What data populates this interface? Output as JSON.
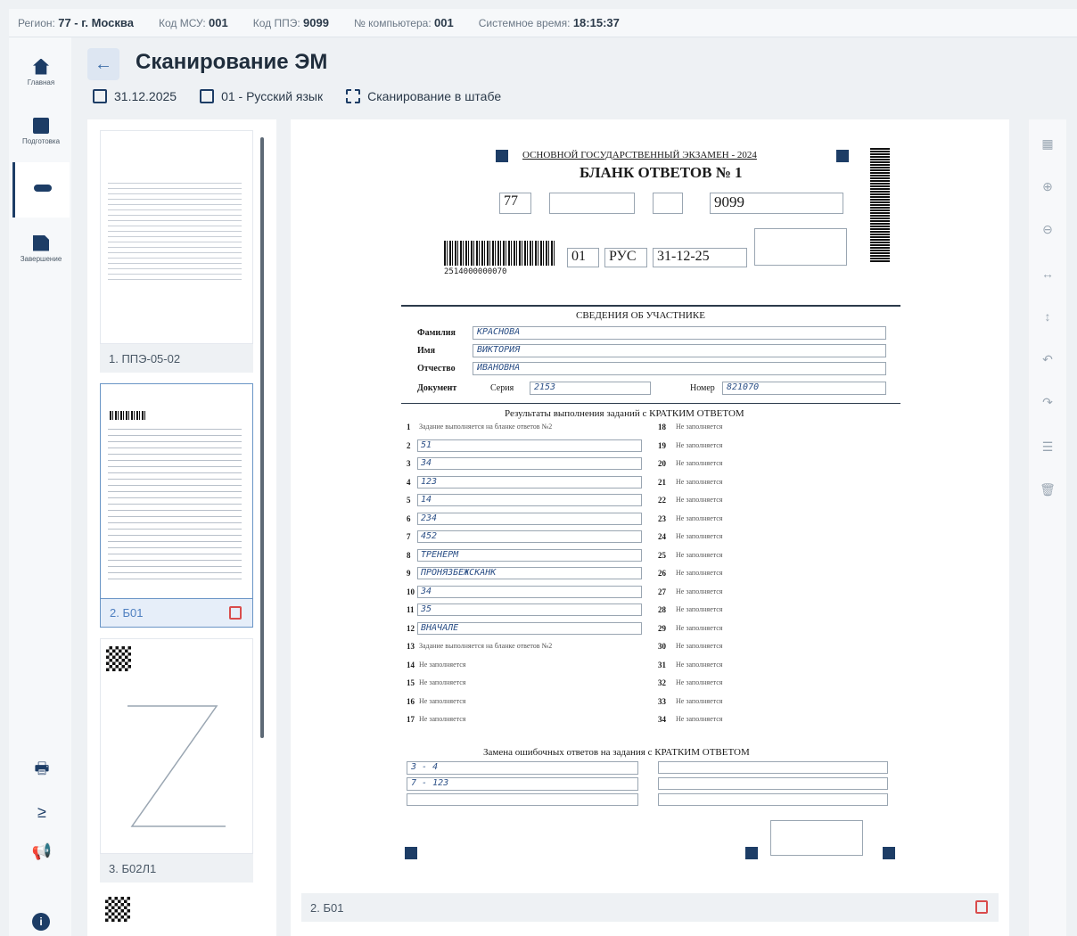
{
  "status": {
    "region_label": "Регион:",
    "region_value": "77 - г. Москва",
    "msu_label": "Код МСУ:",
    "msu_value": "001",
    "ppe_label": "Код ППЭ:",
    "ppe_value": "9099",
    "pc_label": "№ компьютера:",
    "pc_value": "001",
    "time_label": "Системное время:",
    "time_value": "18:15:37"
  },
  "sidebar": {
    "items": [
      {
        "label": "Главная",
        "icon": "home-icon"
      },
      {
        "label": "Подготовка",
        "icon": "calendar-icon"
      },
      {
        "label": "",
        "icon": "key-icon"
      },
      {
        "label": "Завершение",
        "icon": "document-icon"
      }
    ],
    "bottom": [
      "printer-icon",
      "scanner-icon",
      "megaphone-icon",
      "info-icon"
    ]
  },
  "header": {
    "title": "Сканирование ЭМ",
    "date": "31.12.2025",
    "subject": "01 - Русский язык",
    "mode": "Сканирование в штабе"
  },
  "thumbnails": [
    {
      "caption": "1. ППЭ-05-02",
      "selected": false
    },
    {
      "caption": "2. Б01",
      "selected": true
    },
    {
      "caption": "3. Б02Л1",
      "selected": false
    }
  ],
  "viewer": {
    "caption": "2. Б01"
  },
  "toolbar": [
    "grid-icon",
    "zoom-in-icon",
    "zoom-out-icon",
    "fit-width-icon",
    "fit-height-icon",
    "rotate-left-icon",
    "rotate-right-icon",
    "comment-icon",
    "delete-icon"
  ],
  "form": {
    "header1": "ОСНОВНОЙ ГОСУДАРСТВЕННЫЙ ЭКЗАМЕН - 2024",
    "header2": "БЛАНК ОТВЕТОВ № 1",
    "region": "77",
    "ppe": "9099",
    "subject_code": "01",
    "subject_name": "РУС",
    "exam_date": "31-12-25",
    "barcode_number": "2514000000070",
    "section_participant": "СВЕДЕНИЯ ОБ УЧАСТНИКЕ",
    "surname_label": "Фамилия",
    "surname": "КРАСНОВА",
    "name_label": "Имя",
    "name": "ВИКТОРИЯ",
    "patronymic_label": "Отчество",
    "patronymic": "ИВАНОВНА",
    "doc_label": "Документ",
    "series_label": "Серия",
    "series": "2153",
    "number_label": "Номер",
    "number": "821070",
    "results_title": "Результаты выполнения заданий с КРАТКИМ ОТВЕТОМ",
    "answers_left": [
      {
        "n": "1",
        "v": "Задание выполняется на бланке ответов №2"
      },
      {
        "n": "2",
        "v": "51"
      },
      {
        "n": "3",
        "v": "34"
      },
      {
        "n": "4",
        "v": "123"
      },
      {
        "n": "5",
        "v": "14"
      },
      {
        "n": "6",
        "v": "234"
      },
      {
        "n": "7",
        "v": "452"
      },
      {
        "n": "8",
        "v": "ТРЕНЕРМ"
      },
      {
        "n": "9",
        "v": "ПРОНЯЗБЕЖСКАНК"
      },
      {
        "n": "10",
        "v": "34"
      },
      {
        "n": "11",
        "v": "35"
      },
      {
        "n": "12",
        "v": "ВНАЧАЛЕ"
      },
      {
        "n": "13",
        "v": "Задание выполняется на бланке ответов №2"
      },
      {
        "n": "14",
        "v": "Не заполняется"
      },
      {
        "n": "15",
        "v": "Не заполняется"
      },
      {
        "n": "16",
        "v": "Не заполняется"
      },
      {
        "n": "17",
        "v": "Не заполняется"
      }
    ],
    "answers_right": [
      "18",
      "19",
      "20",
      "21",
      "22",
      "23",
      "24",
      "25",
      "26",
      "27",
      "28",
      "29",
      "30",
      "31",
      "32",
      "33",
      "34"
    ],
    "right_text": "Не заполняется",
    "replace_title": "Замена ошибочных ответов на задания с КРАТКИМ ОТВЕТОМ",
    "replace_rows": [
      {
        "n": "3",
        "v": "4"
      },
      {
        "n": "7",
        "v": "123"
      }
    ]
  }
}
